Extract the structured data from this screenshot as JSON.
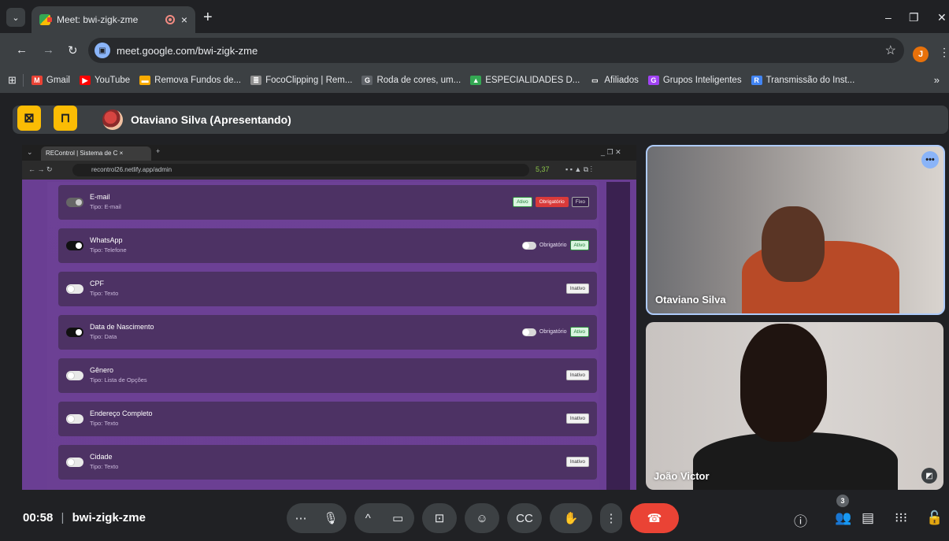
{
  "tab": {
    "title": "Meet: bwi-zigk-zme",
    "close": "×",
    "new": "+"
  },
  "omnibox": {
    "url": "meet.google.com/bwi-zigk-zme",
    "profile_initial": "J"
  },
  "bookmarks": [
    {
      "label": "Gmail",
      "color": "#ea4335",
      "glyph": "M"
    },
    {
      "label": "YouTube",
      "color": "#ff0000",
      "glyph": "▶"
    },
    {
      "label": "Remova Fundos de...",
      "color": "#f9ab00",
      "glyph": "▬"
    },
    {
      "label": "FocoClipping | Rem...",
      "color": "#8e8e8e",
      "glyph": "≣"
    },
    {
      "label": "Roda de cores, um...",
      "color": "#5f6368",
      "glyph": "G"
    },
    {
      "label": "ESPECIALIDADES D...",
      "color": "#34a853",
      "glyph": "▲"
    },
    {
      "label": "Afiliados",
      "color": "transparent",
      "glyph": "▭"
    },
    {
      "label": "Grupos Inteligentes",
      "color": "#a142f4",
      "glyph": "G"
    },
    {
      "label": "Transmissão do Inst...",
      "color": "#4285f4",
      "glyph": "R"
    }
  ],
  "presenter": {
    "name": "Otaviano Silva (Apresentando)"
  },
  "shared_screen": {
    "tab_title": "REControl | Sistema de C",
    "url": "recontrol26.netlify.app/admin",
    "extension_count": "5,37",
    "fields": [
      {
        "title": "E-mail",
        "type": "Tipo: E-mail",
        "toggle": "mid",
        "badges": [
          [
            "Ativo",
            "green"
          ],
          [
            "Obrigatório",
            "red"
          ],
          [
            "Fixo",
            "outline"
          ]
        ],
        "obrig_toggle": false
      },
      {
        "title": "WhatsApp",
        "type": "Tipo: Telefone",
        "toggle": "on",
        "badges": [
          [
            "Ativo",
            "green"
          ]
        ],
        "obrig_toggle": true
      },
      {
        "title": "CPF",
        "type": "Tipo: Texto",
        "toggle": "off",
        "badges": [
          [
            "Inativo",
            "inactive"
          ]
        ],
        "obrig_toggle": false
      },
      {
        "title": "Data de Nascimento",
        "type": "Tipo: Data",
        "toggle": "on",
        "badges": [
          [
            "Ativo",
            "green"
          ]
        ],
        "obrig_toggle": true
      },
      {
        "title": "Gênero",
        "type": "Tipo: Lista de Opções",
        "toggle": "off",
        "badges": [
          [
            "Inativo",
            "inactive"
          ]
        ],
        "obrig_toggle": false
      },
      {
        "title": "Endereço Completo",
        "type": "Tipo: Texto",
        "toggle": "off",
        "badges": [
          [
            "Inativo",
            "inactive"
          ]
        ],
        "obrig_toggle": false
      },
      {
        "title": "Cidade",
        "type": "Tipo: Texto",
        "toggle": "off",
        "badges": [
          [
            "Inativo",
            "inactive"
          ]
        ],
        "obrig_toggle": false
      }
    ],
    "obrig_label": "Obrigatório"
  },
  "participants": [
    {
      "name": "Otaviano Silva"
    },
    {
      "name": "João Victor"
    }
  ],
  "controls": {
    "time": "00:58",
    "meeting_code": "bwi-zigk-zme",
    "separator": "|",
    "participant_count": "3"
  },
  "colors": {
    "accent": "#8ab4f8",
    "end_call": "#ea4335",
    "presenting": "#fbbc04"
  }
}
